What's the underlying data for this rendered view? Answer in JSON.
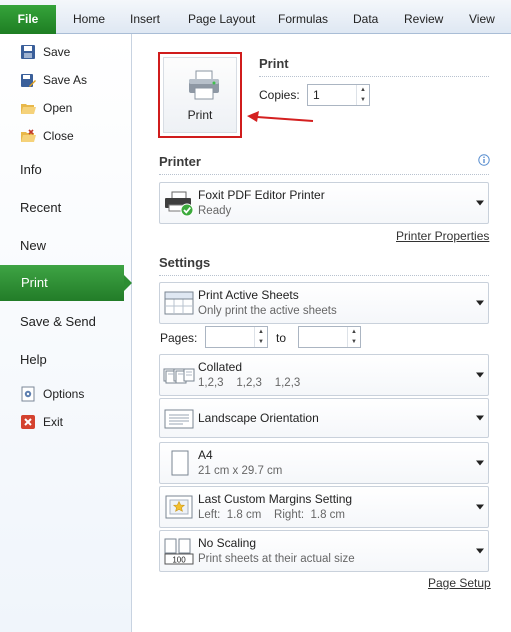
{
  "ribbon": {
    "file": "File",
    "tabs": [
      "Home",
      "Insert",
      "Page Layout",
      "Formulas",
      "Data",
      "Review",
      "View"
    ]
  },
  "nav": {
    "save": "Save",
    "save_as": "Save As",
    "open": "Open",
    "close": "Close",
    "info": "Info",
    "recent": "Recent",
    "new": "New",
    "print": "Print",
    "save_send": "Save & Send",
    "help": "Help",
    "options": "Options",
    "exit": "Exit"
  },
  "print": {
    "button_label": "Print",
    "section_title": "Print",
    "copies_label": "Copies:",
    "copies_value": "1"
  },
  "printer": {
    "section_title": "Printer",
    "name": "Foxit PDF Editor Printer",
    "status": "Ready",
    "properties_link": "Printer Properties",
    "info_icon": "info-icon"
  },
  "settings": {
    "section_title": "Settings",
    "active_sheets_title": "Print Active Sheets",
    "active_sheets_desc": "Only print the active sheets",
    "pages_label": "Pages:",
    "pages_from": "",
    "to_label": "to",
    "pages_to": "",
    "collated_title": "Collated",
    "collated_desc": "1,2,3    1,2,3    1,2,3",
    "orientation_title": "Landscape Orientation",
    "paper_title": "A4",
    "paper_desc": "21 cm x 29.7 cm",
    "margins_title": "Last Custom Margins Setting",
    "margins_desc": "Left:  1.8 cm    Right:  1.8 cm",
    "scaling_title": "No Scaling",
    "scaling_desc": "Print sheets at their actual size",
    "scaling_icon_text": "100",
    "page_setup_link": "Page Setup"
  },
  "colors": {
    "file_green": "#1e7e23",
    "selected_green": "#2c8d32",
    "highlight_red": "#d01c1c"
  }
}
